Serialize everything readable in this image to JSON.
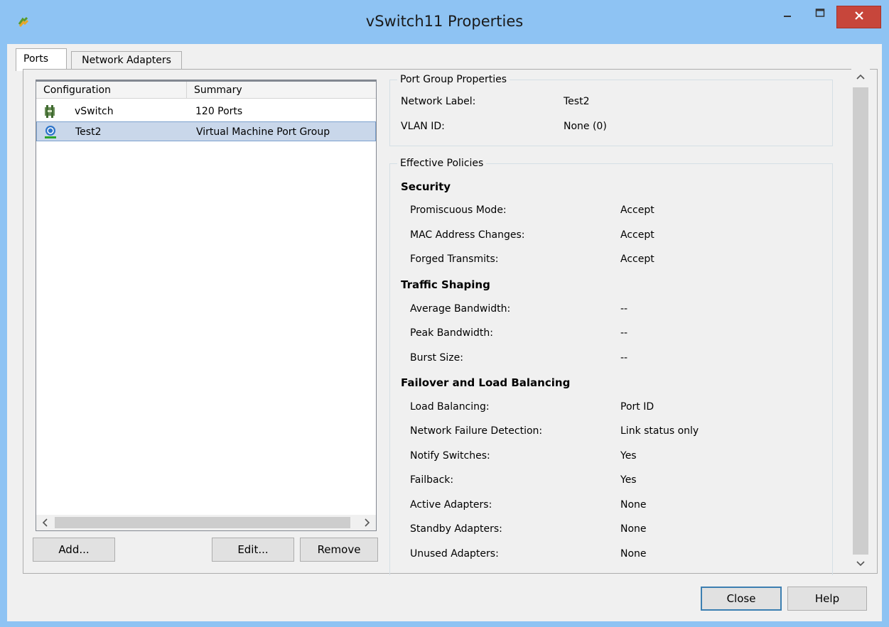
{
  "window": {
    "title": "vSwitch11 Properties",
    "icon": "vsphere-app-icon",
    "titlebar_color": "#8ec3f3",
    "close_button_color": "#c7463b"
  },
  "tabs": {
    "ports": "Ports",
    "network_adapters": "Network Adapters"
  },
  "list": {
    "columns": {
      "configuration": "Configuration",
      "summary": "Summary"
    },
    "rows": [
      {
        "name": "vSwitch",
        "summary": "120 Ports",
        "icon": "vswitch-icon"
      },
      {
        "name": "Test2",
        "summary": "Virtual Machine Port Group",
        "icon": "port-group-icon",
        "selected": true
      }
    ]
  },
  "buttons": {
    "add": "Add...",
    "edit": "Edit...",
    "remove": "Remove",
    "close": "Close",
    "help": "Help"
  },
  "port_group": {
    "title": "Port Group Properties",
    "network_label": {
      "label": "Network Label:",
      "value": "Test2"
    },
    "vlan_id": {
      "label": "VLAN ID:",
      "value": "None (0)"
    }
  },
  "policies": {
    "title": "Effective Policies",
    "security": {
      "heading": "Security",
      "promiscuous": {
        "label": "Promiscuous Mode:",
        "value": "Accept"
      },
      "mac_changes": {
        "label": "MAC Address Changes:",
        "value": "Accept"
      },
      "forged": {
        "label": "Forged Transmits:",
        "value": "Accept"
      }
    },
    "traffic": {
      "heading": "Traffic Shaping",
      "avg": {
        "label": "Average Bandwidth:",
        "value": "--"
      },
      "peak": {
        "label": "Peak Bandwidth:",
        "value": "--"
      },
      "burst": {
        "label": "Burst Size:",
        "value": "--"
      }
    },
    "failover": {
      "heading": "Failover and Load Balancing",
      "load_balancing": {
        "label": "Load Balancing:",
        "value": "Port ID"
      },
      "failure_detection": {
        "label": "Network Failure Detection:",
        "value": "Link status only"
      },
      "notify": {
        "label": "Notify Switches:",
        "value": "Yes"
      },
      "failback": {
        "label": "Failback:",
        "value": "Yes"
      },
      "active": {
        "label": "Active Adapters:",
        "value": "None"
      },
      "standby": {
        "label": "Standby Adapters:",
        "value": "None"
      },
      "unused": {
        "label": "Unused Adapters:",
        "value": "None"
      }
    }
  }
}
